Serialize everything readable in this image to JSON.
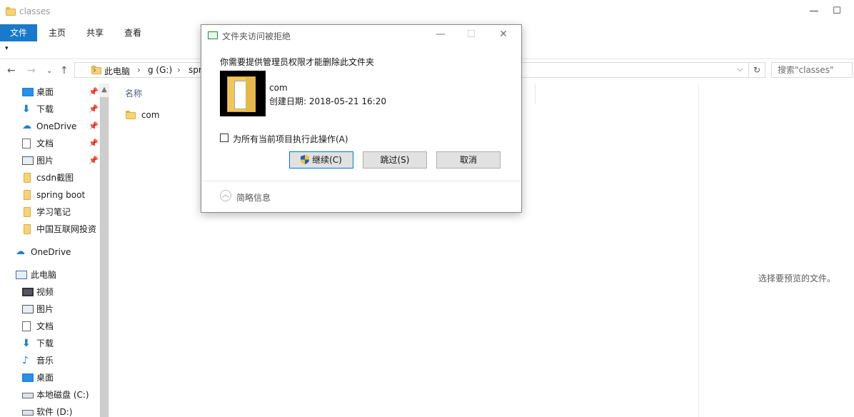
{
  "window": {
    "title": "classes"
  },
  "ribbon": {
    "tabs": [
      "文件",
      "主页",
      "共享",
      "查看"
    ]
  },
  "address": {
    "crumbs": [
      "此电脑",
      "g (G:)",
      "spr"
    ],
    "search_placeholder": "搜索\"classes\""
  },
  "nav": {
    "quick_access": [
      {
        "label": "桌面",
        "icon": "desktop-icon",
        "pinned": true
      },
      {
        "label": "下载",
        "icon": "download-icon",
        "pinned": true
      },
      {
        "label": "OneDrive",
        "icon": "onedrive-icon",
        "pinned": true
      },
      {
        "label": "文档",
        "icon": "documents-icon",
        "pinned": true
      },
      {
        "label": "图片",
        "icon": "pictures-icon",
        "pinned": true
      },
      {
        "label": "csdn截图",
        "icon": "folder-icon",
        "pinned": false
      },
      {
        "label": "spring boot",
        "icon": "folder-icon",
        "pinned": false
      },
      {
        "label": "学习笔记",
        "icon": "folder-icon",
        "pinned": false
      },
      {
        "label": "中国互联网投资",
        "icon": "folder-icon",
        "pinned": false
      }
    ],
    "onedrive": "OneDrive",
    "this_pc": "此电脑",
    "pc_items": [
      {
        "label": "视频",
        "icon": "videos-icon"
      },
      {
        "label": "图片",
        "icon": "pictures-icon"
      },
      {
        "label": "文档",
        "icon": "documents-icon"
      },
      {
        "label": "下载",
        "icon": "download-icon"
      },
      {
        "label": "音乐",
        "icon": "music-icon"
      },
      {
        "label": "桌面",
        "icon": "desktop-icon"
      },
      {
        "label": "本地磁盘 (C:)",
        "icon": "drive-icon"
      },
      {
        "label": "软件 (D:)",
        "icon": "drive-icon"
      }
    ]
  },
  "content": {
    "column_name": "名称",
    "files": [
      {
        "name": "com"
      }
    ],
    "preview_text": "选择要预览的文件。"
  },
  "dialog": {
    "title": "文件夹访问被拒绝",
    "message": "你需要提供管理员权限才能删除此文件夹",
    "item_name": "com",
    "item_date": "创建日期: 2018-05-21 16:20",
    "checkbox_label": "为所有当前项目执行此操作(A)",
    "continue_label": "继续(C)",
    "skip_label": "跳过(S)",
    "cancel_label": "取消",
    "more_info": "简略信息"
  },
  "colors": {
    "accent": "#1979ca",
    "dialog_border": "#0078d7"
  }
}
